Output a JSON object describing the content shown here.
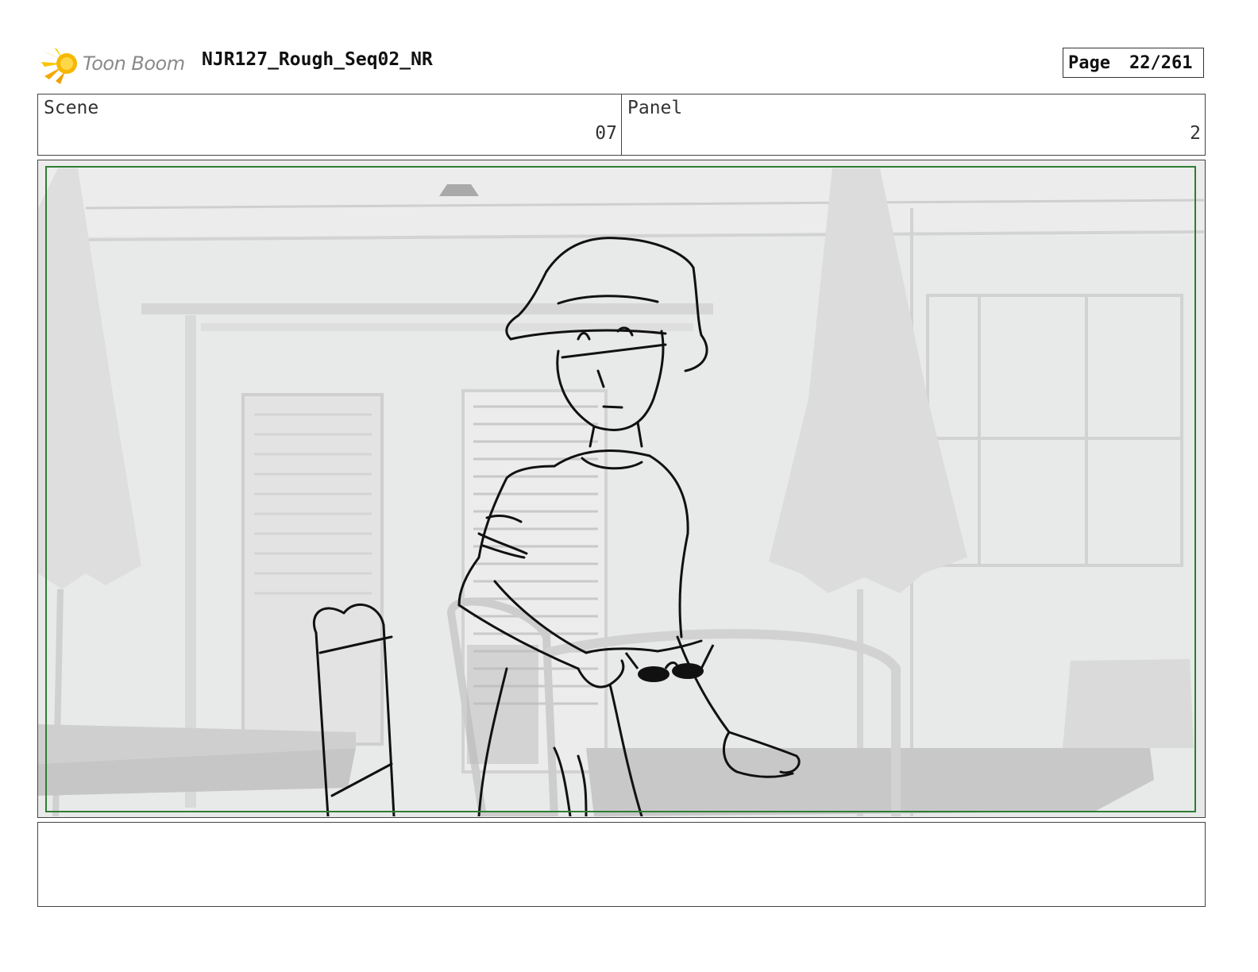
{
  "header": {
    "logo_text": "Toon Boom",
    "project_title": "NJR127_Rough_Seq02_NR",
    "page_label": "Page",
    "page_value": "22/261"
  },
  "info": {
    "scene_label": "Scene",
    "scene_value": "07",
    "panel_label": "Panel",
    "panel_value": "2"
  },
  "frame": {
    "border_color": "#2e7d32"
  },
  "notes": {
    "text": ""
  }
}
